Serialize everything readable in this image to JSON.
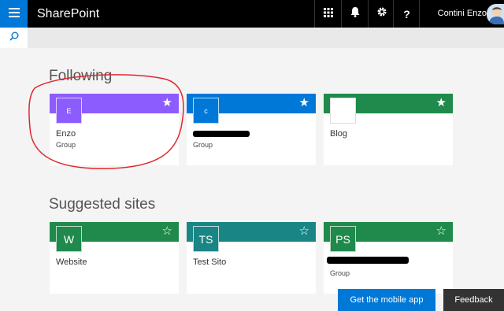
{
  "app": {
    "title": "SharePoint"
  },
  "topbar": {
    "icons": [
      "app-launcher-icon",
      "bell-icon",
      "gear-icon",
      "help-icon"
    ],
    "help_label": "?",
    "user_name": "Contini Enzo",
    "accent": "#0078d7"
  },
  "following": {
    "heading": "Following",
    "cards": [
      {
        "tile": "E",
        "name": "Enzo",
        "sub": "Group",
        "color": "#8c5cff",
        "followed": true
      },
      {
        "tile": "c",
        "name": "",
        "sub": "Group",
        "color": "#0078d7",
        "followed": true
      },
      {
        "tile": "",
        "name": "Blog",
        "sub": "",
        "color": "#1f8a4c",
        "followed": true
      }
    ]
  },
  "suggested": {
    "heading": "Suggested sites",
    "cards": [
      {
        "tile": "W",
        "name": "Website",
        "sub": "",
        "color": "#1f8a4c",
        "followed": false
      },
      {
        "tile": "TS",
        "name": "Test Sito",
        "sub": "",
        "color": "#1a8585",
        "followed": false
      },
      {
        "tile": "PS",
        "name": "",
        "sub": "Group",
        "color": "#1f8a4c",
        "followed": false
      }
    ]
  },
  "star_filled": "★",
  "star_empty": "☆",
  "footer": {
    "mobile_app": "Get the mobile app",
    "feedback": "Feedback"
  }
}
